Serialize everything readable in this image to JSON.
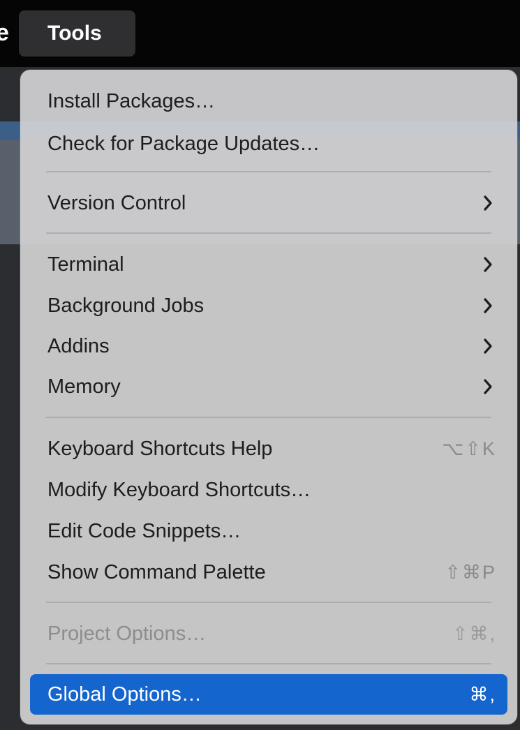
{
  "menubar": {
    "partial_prev_label": "e",
    "active_menu_label": "Tools"
  },
  "menu": {
    "items": [
      {
        "label": "Install Packages…"
      },
      {
        "label": "Check for Package Updates…"
      },
      {
        "label": "Version Control",
        "submenu": true
      },
      {
        "label": "Terminal",
        "submenu": true
      },
      {
        "label": "Background Jobs",
        "submenu": true
      },
      {
        "label": "Addins",
        "submenu": true
      },
      {
        "label": "Memory",
        "submenu": true
      },
      {
        "label": "Keyboard Shortcuts Help",
        "shortcut": "⌥⇧K"
      },
      {
        "label": "Modify Keyboard Shortcuts…"
      },
      {
        "label": "Edit Code Snippets…"
      },
      {
        "label": "Show Command Palette",
        "shortcut": "⇧⌘P"
      },
      {
        "label": "Project Options…",
        "shortcut": "⇧⌘,",
        "disabled": true
      },
      {
        "label": "Global Options…",
        "shortcut": "⌘,",
        "selected": true
      }
    ]
  },
  "colors": {
    "menu_background": "#d2d2d4",
    "selection": "#1565cf",
    "menubar_highlight": "#2f2f31"
  },
  "icons": {
    "submenu": "chevron-right-icon"
  }
}
